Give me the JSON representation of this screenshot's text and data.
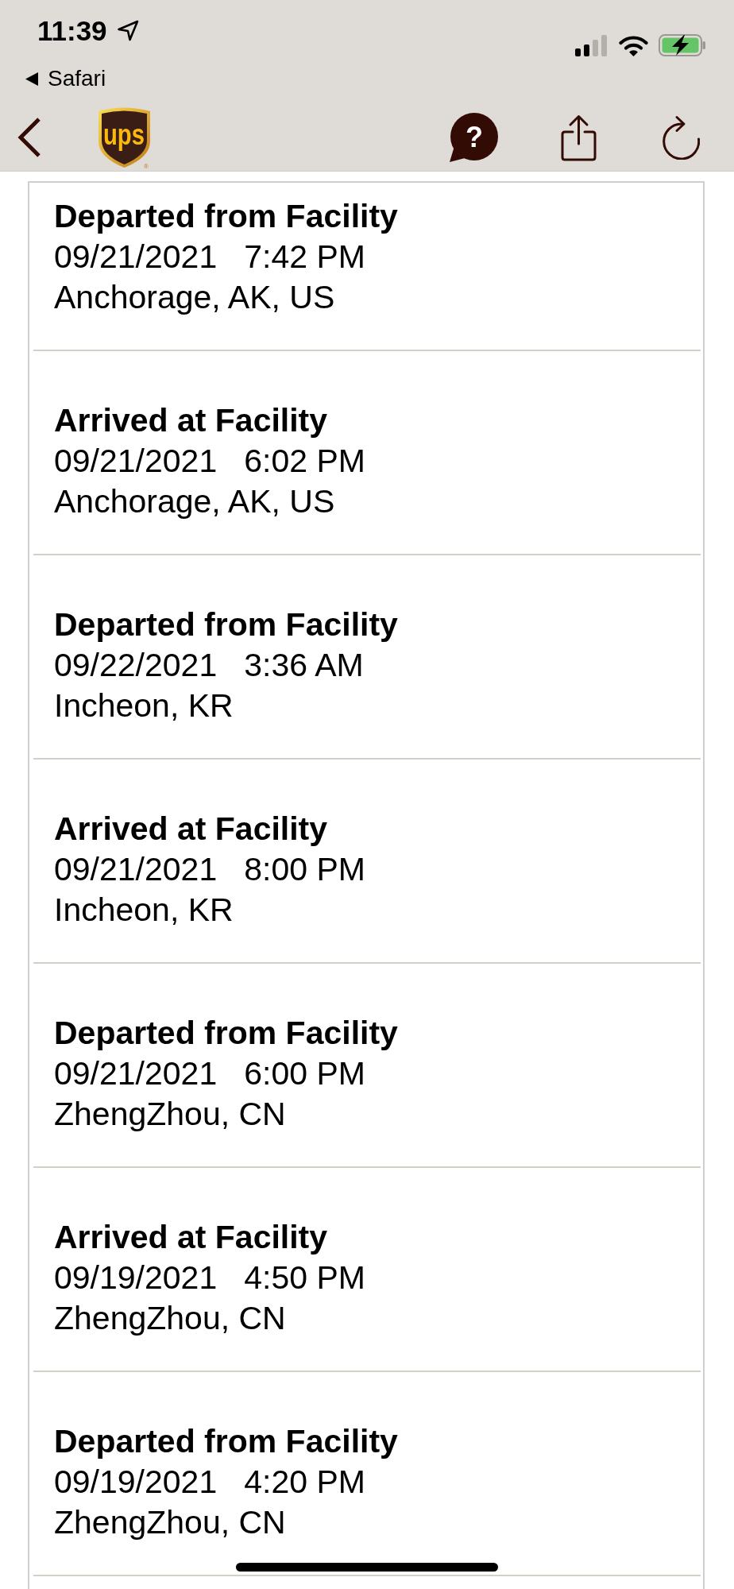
{
  "status_bar": {
    "time": "11:39",
    "back_app": "Safari"
  },
  "nav_bar": {
    "logo": {
      "text": "ups",
      "mark": "®"
    },
    "help_symbol": "?"
  },
  "events": [
    {
      "status": "Departed from Facility",
      "date": "09/21/2021",
      "time": "7:42 PM",
      "location": "Anchorage, AK, US"
    },
    {
      "status": "Arrived at Facility",
      "date": "09/21/2021",
      "time": "6:02 PM",
      "location": "Anchorage, AK, US"
    },
    {
      "status": "Departed from Facility",
      "date": "09/22/2021",
      "time": "3:36 AM",
      "location": "Incheon, KR"
    },
    {
      "status": "Arrived at Facility",
      "date": "09/21/2021",
      "time": "8:00 PM",
      "location": "Incheon, KR"
    },
    {
      "status": "Departed from Facility",
      "date": "09/21/2021",
      "time": "6:00 PM",
      "location": "ZhengZhou, CN"
    },
    {
      "status": "Arrived at Facility",
      "date": "09/19/2021",
      "time": "4:50 PM",
      "location": "ZhengZhou, CN"
    },
    {
      "status": "Departed from Facility",
      "date": "09/19/2021",
      "time": "4:20 PM",
      "location": "ZhengZhou, CN"
    }
  ]
}
